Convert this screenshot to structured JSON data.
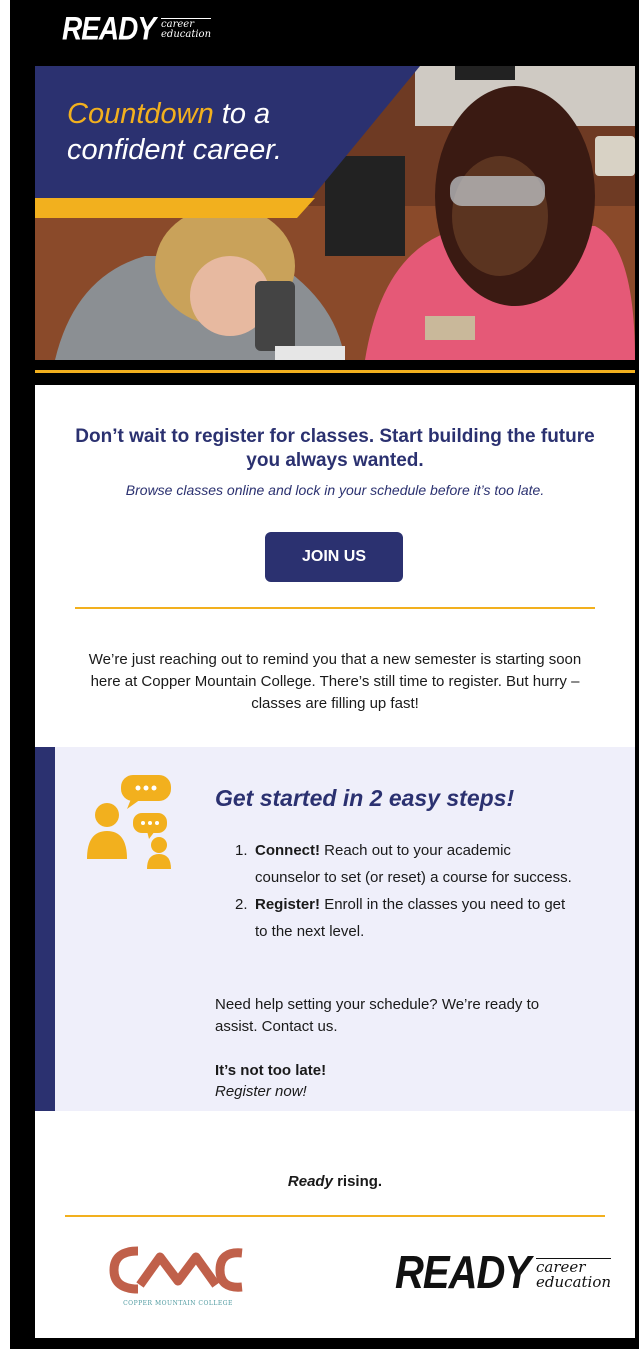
{
  "header": {
    "brand": "READY",
    "brand_sub_1": "career",
    "brand_sub_2": "education"
  },
  "hero": {
    "highlight": "Countdown",
    "line1_rest": " to a",
    "line2": "confident career."
  },
  "intro": {
    "headline": "Don’t wait to register for classes. Start building the future you always wanted.",
    "subline": "Browse classes online and lock in your schedule before it’s too late.",
    "cta_label": "JOIN US"
  },
  "body": {
    "text": "We’re just reaching out to remind you that a new semester is starting soon here at Copper Mountain College. There’s still time to register. But hurry – classes are filling up fast!"
  },
  "steps": {
    "title": "Get started in 2 easy steps!",
    "items": [
      {
        "num": "1.",
        "bold": "Connect!",
        "text": " Reach out to your academic counselor to set (or reset) a course for success."
      },
      {
        "num": "2.",
        "bold": "Register!",
        "text": " Enroll in the classes you need to get to the next level."
      }
    ],
    "help": "Need help setting your schedule? We’re ready to assist. Contact us.",
    "late_bold": "It’s not too late!",
    "late_italic": "Register now!"
  },
  "footer": {
    "rising_italic": "Ready",
    "rising_rest": " rising.",
    "cmc_caption": "COPPER MOUNTAIN COLLEGE",
    "brand": "READY",
    "brand_sub_1": "career",
    "brand_sub_2": "education"
  },
  "colors": {
    "navy": "#2b3170",
    "gold": "#f2b01e",
    "panel": "#efeffa",
    "cmc_red": "#c0604a"
  },
  "icons": {
    "steps": "people-chat-icon"
  }
}
